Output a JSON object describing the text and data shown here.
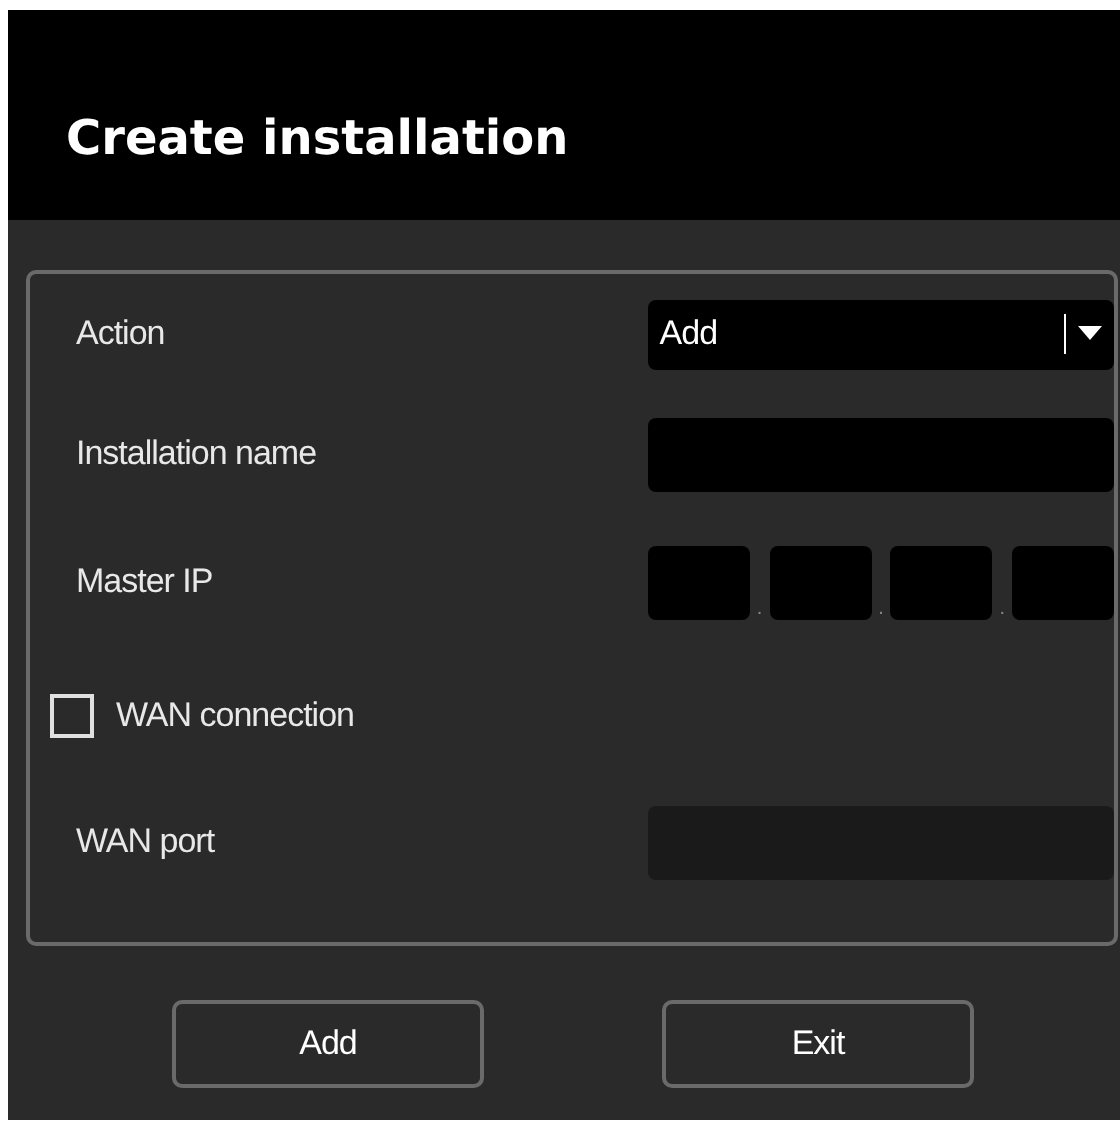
{
  "title": "Create installation",
  "rows": [
    {
      "kind": "select",
      "label": "Action",
      "value": "Add"
    },
    {
      "kind": "text",
      "label": "Installation name",
      "disabled": false
    },
    {
      "kind": "ip",
      "label": "Master IP",
      "separators": [
        ".",
        ".",
        "."
      ]
    },
    {
      "kind": "checkbox",
      "label": "WAN connection",
      "checked": false
    },
    {
      "kind": "text",
      "label": "WAN port",
      "disabled": true
    }
  ],
  "buttons": [
    "Add",
    "Exit"
  ]
}
